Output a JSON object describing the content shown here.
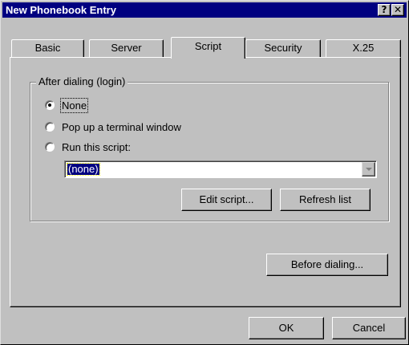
{
  "window": {
    "title": "New Phonebook Entry",
    "help_glyph": "?",
    "close_glyph": "✕"
  },
  "tabs": [
    {
      "label": "Basic",
      "active": false
    },
    {
      "label": "Server",
      "active": false
    },
    {
      "label": "Script",
      "active": true
    },
    {
      "label": "Security",
      "active": false
    },
    {
      "label": "X.25",
      "active": false
    }
  ],
  "script_page": {
    "group_label": "After dialing (login)",
    "options": [
      {
        "label": "None",
        "checked": true
      },
      {
        "label": "Pop up a terminal window",
        "checked": false
      },
      {
        "label": "Run this script:",
        "checked": false
      }
    ],
    "script_select": {
      "value": "(none)",
      "enabled": false
    },
    "edit_script_label": "Edit script...",
    "refresh_list_label": "Refresh list",
    "before_dialing_label": "Before dialing..."
  },
  "footer": {
    "ok_label": "OK",
    "cancel_label": "Cancel"
  },
  "colors": {
    "titlebar": "#000080",
    "face": "#c0c0c0",
    "selection": "#000080"
  }
}
